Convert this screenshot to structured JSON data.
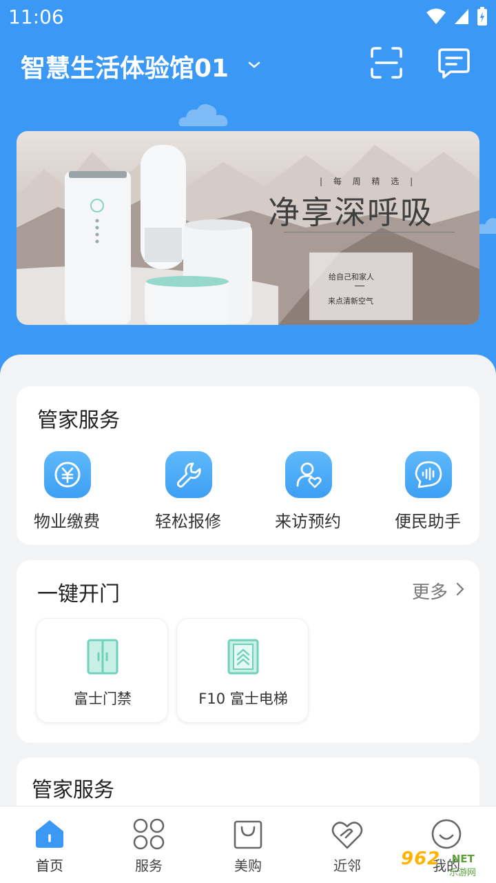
{
  "status_bar": {
    "time": "11:06"
  },
  "header": {
    "community_name": "智慧生活体验馆01",
    "bg_color": "#3b98f5",
    "scan_icon": "scan-frame-icon",
    "message_icon": "message-icon"
  },
  "banner": {
    "tag": "| 每 周 精 选 |",
    "headline": "净享深呼吸",
    "line1": "给自己和家人",
    "line2": "来点清新空气"
  },
  "services": {
    "title": "管家服务",
    "items": [
      {
        "label": "物业缴费",
        "icon": "yen-icon"
      },
      {
        "label": "轻松报修",
        "icon": "wrench-icon"
      },
      {
        "label": "来访预约",
        "icon": "visitor-heart-icon"
      },
      {
        "label": "便民助手",
        "icon": "voice-assistant-icon"
      }
    ]
  },
  "door": {
    "title": "一键开门",
    "more": "更多",
    "items": [
      {
        "label": "富士门禁",
        "icon": "door-icon"
      },
      {
        "label": "F10 富士电梯",
        "icon": "elevator-icon"
      }
    ]
  },
  "services2": {
    "title": "管家服务"
  },
  "tabbar": {
    "items": [
      {
        "label": "首页",
        "icon": "home-icon"
      },
      {
        "label": "服务",
        "icon": "grid-icon"
      },
      {
        "label": "美购",
        "icon": "shopping-bag-icon"
      },
      {
        "label": "近邻",
        "icon": "neighbor-heart-icon"
      },
      {
        "label": "我的",
        "icon": "smile-icon"
      }
    ],
    "active_color": "#3b98f5"
  },
  "watermark": {
    "brand": "962",
    "net": ".NET",
    "sub": "乐游网"
  }
}
